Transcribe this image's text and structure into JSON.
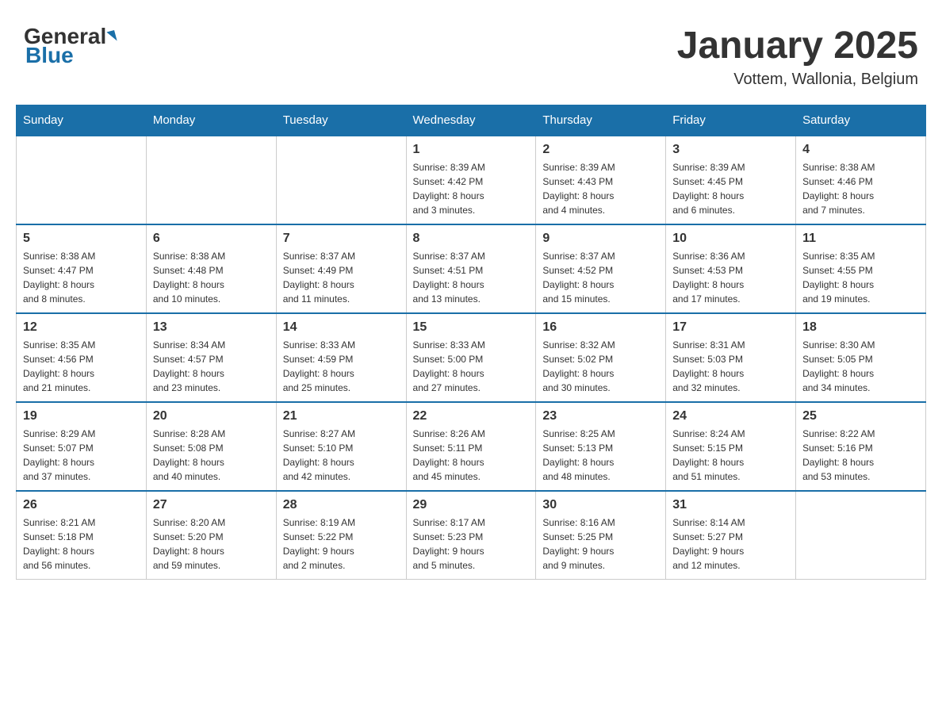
{
  "header": {
    "logo_general": "General",
    "logo_blue": "Blue",
    "title": "January 2025",
    "location": "Vottem, Wallonia, Belgium"
  },
  "days_of_week": [
    "Sunday",
    "Monday",
    "Tuesday",
    "Wednesday",
    "Thursday",
    "Friday",
    "Saturday"
  ],
  "weeks": [
    [
      {
        "day": "",
        "info": ""
      },
      {
        "day": "",
        "info": ""
      },
      {
        "day": "",
        "info": ""
      },
      {
        "day": "1",
        "info": "Sunrise: 8:39 AM\nSunset: 4:42 PM\nDaylight: 8 hours\nand 3 minutes."
      },
      {
        "day": "2",
        "info": "Sunrise: 8:39 AM\nSunset: 4:43 PM\nDaylight: 8 hours\nand 4 minutes."
      },
      {
        "day": "3",
        "info": "Sunrise: 8:39 AM\nSunset: 4:45 PM\nDaylight: 8 hours\nand 6 minutes."
      },
      {
        "day": "4",
        "info": "Sunrise: 8:38 AM\nSunset: 4:46 PM\nDaylight: 8 hours\nand 7 minutes."
      }
    ],
    [
      {
        "day": "5",
        "info": "Sunrise: 8:38 AM\nSunset: 4:47 PM\nDaylight: 8 hours\nand 8 minutes."
      },
      {
        "day": "6",
        "info": "Sunrise: 8:38 AM\nSunset: 4:48 PM\nDaylight: 8 hours\nand 10 minutes."
      },
      {
        "day": "7",
        "info": "Sunrise: 8:37 AM\nSunset: 4:49 PM\nDaylight: 8 hours\nand 11 minutes."
      },
      {
        "day": "8",
        "info": "Sunrise: 8:37 AM\nSunset: 4:51 PM\nDaylight: 8 hours\nand 13 minutes."
      },
      {
        "day": "9",
        "info": "Sunrise: 8:37 AM\nSunset: 4:52 PM\nDaylight: 8 hours\nand 15 minutes."
      },
      {
        "day": "10",
        "info": "Sunrise: 8:36 AM\nSunset: 4:53 PM\nDaylight: 8 hours\nand 17 minutes."
      },
      {
        "day": "11",
        "info": "Sunrise: 8:35 AM\nSunset: 4:55 PM\nDaylight: 8 hours\nand 19 minutes."
      }
    ],
    [
      {
        "day": "12",
        "info": "Sunrise: 8:35 AM\nSunset: 4:56 PM\nDaylight: 8 hours\nand 21 minutes."
      },
      {
        "day": "13",
        "info": "Sunrise: 8:34 AM\nSunset: 4:57 PM\nDaylight: 8 hours\nand 23 minutes."
      },
      {
        "day": "14",
        "info": "Sunrise: 8:33 AM\nSunset: 4:59 PM\nDaylight: 8 hours\nand 25 minutes."
      },
      {
        "day": "15",
        "info": "Sunrise: 8:33 AM\nSunset: 5:00 PM\nDaylight: 8 hours\nand 27 minutes."
      },
      {
        "day": "16",
        "info": "Sunrise: 8:32 AM\nSunset: 5:02 PM\nDaylight: 8 hours\nand 30 minutes."
      },
      {
        "day": "17",
        "info": "Sunrise: 8:31 AM\nSunset: 5:03 PM\nDaylight: 8 hours\nand 32 minutes."
      },
      {
        "day": "18",
        "info": "Sunrise: 8:30 AM\nSunset: 5:05 PM\nDaylight: 8 hours\nand 34 minutes."
      }
    ],
    [
      {
        "day": "19",
        "info": "Sunrise: 8:29 AM\nSunset: 5:07 PM\nDaylight: 8 hours\nand 37 minutes."
      },
      {
        "day": "20",
        "info": "Sunrise: 8:28 AM\nSunset: 5:08 PM\nDaylight: 8 hours\nand 40 minutes."
      },
      {
        "day": "21",
        "info": "Sunrise: 8:27 AM\nSunset: 5:10 PM\nDaylight: 8 hours\nand 42 minutes."
      },
      {
        "day": "22",
        "info": "Sunrise: 8:26 AM\nSunset: 5:11 PM\nDaylight: 8 hours\nand 45 minutes."
      },
      {
        "day": "23",
        "info": "Sunrise: 8:25 AM\nSunset: 5:13 PM\nDaylight: 8 hours\nand 48 minutes."
      },
      {
        "day": "24",
        "info": "Sunrise: 8:24 AM\nSunset: 5:15 PM\nDaylight: 8 hours\nand 51 minutes."
      },
      {
        "day": "25",
        "info": "Sunrise: 8:22 AM\nSunset: 5:16 PM\nDaylight: 8 hours\nand 53 minutes."
      }
    ],
    [
      {
        "day": "26",
        "info": "Sunrise: 8:21 AM\nSunset: 5:18 PM\nDaylight: 8 hours\nand 56 minutes."
      },
      {
        "day": "27",
        "info": "Sunrise: 8:20 AM\nSunset: 5:20 PM\nDaylight: 8 hours\nand 59 minutes."
      },
      {
        "day": "28",
        "info": "Sunrise: 8:19 AM\nSunset: 5:22 PM\nDaylight: 9 hours\nand 2 minutes."
      },
      {
        "day": "29",
        "info": "Sunrise: 8:17 AM\nSunset: 5:23 PM\nDaylight: 9 hours\nand 5 minutes."
      },
      {
        "day": "30",
        "info": "Sunrise: 8:16 AM\nSunset: 5:25 PM\nDaylight: 9 hours\nand 9 minutes."
      },
      {
        "day": "31",
        "info": "Sunrise: 8:14 AM\nSunset: 5:27 PM\nDaylight: 9 hours\nand 12 minutes."
      },
      {
        "day": "",
        "info": ""
      }
    ]
  ]
}
